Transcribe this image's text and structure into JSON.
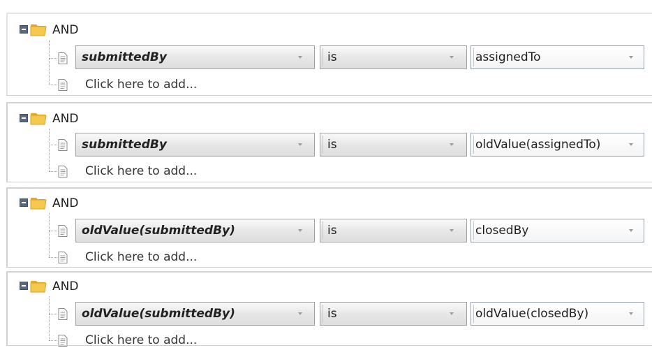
{
  "conditions": [
    {
      "group_label": "AND",
      "field": "submittedBy",
      "operator": "is",
      "value": "assignedTo",
      "add_prompt": "Click here to add..."
    },
    {
      "group_label": "AND",
      "field": "submittedBy",
      "operator": "is",
      "value": "oldValue(assignedTo)",
      "add_prompt": "Click here to add..."
    },
    {
      "group_label": "AND",
      "field": "oldValue(submittedBy)",
      "operator": "is",
      "value": "closedBy",
      "add_prompt": "Click here to add..."
    },
    {
      "group_label": "AND",
      "field": "oldValue(submittedBy)",
      "operator": "is",
      "value": "oldValue(closedBy)",
      "add_prompt": "Click here to add..."
    }
  ],
  "icons": {
    "collapse": "collapse-minus-icon",
    "folder": "folder-icon",
    "document": "document-icon",
    "dropdown": "chevron-down-icon"
  },
  "colors": {
    "folder": "#f5c64b",
    "collapse_button": "#5a6a7a",
    "panel_border": "#d2d2d2"
  }
}
